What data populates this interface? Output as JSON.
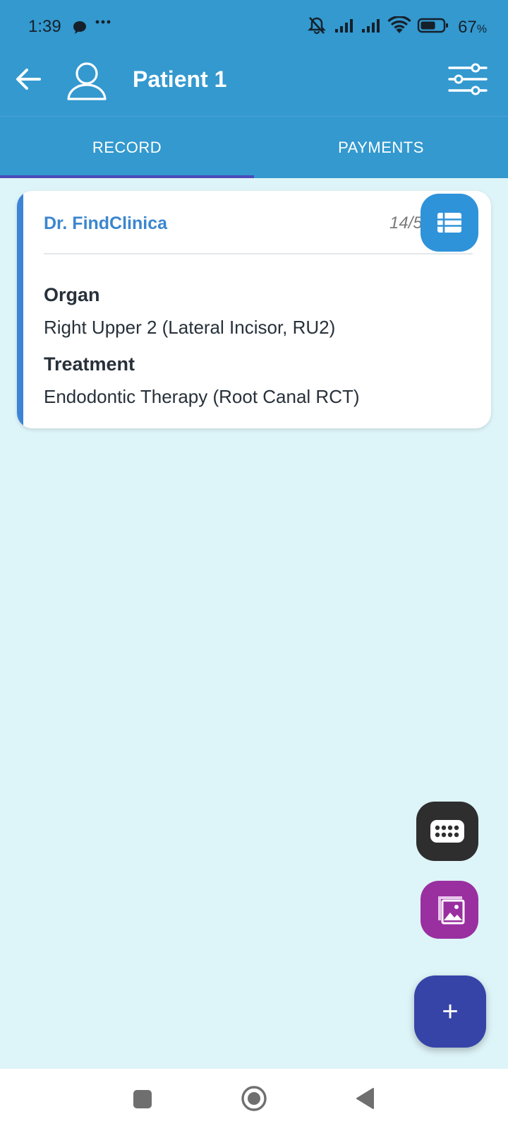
{
  "status_bar": {
    "time": "1:39",
    "battery_percent": "67",
    "battery_unit": "%",
    "battery_level": 0.67,
    "icons": [
      "chat-icon",
      "more-dots-icon",
      "mute-icon",
      "signal-icon",
      "signal-icon",
      "wifi-icon",
      "battery-icon"
    ]
  },
  "header": {
    "title": "Patient 1",
    "icons": [
      "back-arrow-icon",
      "person-icon",
      "filter-sliders-icon"
    ]
  },
  "tabs": [
    {
      "label": "RECORD",
      "active": true
    },
    {
      "label": "PAYMENTS",
      "active": false
    }
  ],
  "record_card": {
    "doctor": "Dr. FindClinica",
    "date": "14/5",
    "fields": [
      {
        "label": "Organ",
        "value": "Right Upper 2 (Lateral Incisor, RU2)"
      },
      {
        "label": "Treatment",
        "value": "Endodontic Therapy (Root Canal RCT)"
      }
    ],
    "icon": "list-icon"
  },
  "fabs": [
    {
      "name": "teeth-icon",
      "color": "#2e2e2e"
    },
    {
      "name": "gallery-icon",
      "color": "#9a2fa0"
    },
    {
      "name": "plus-icon",
      "label": "+",
      "color": "#3644a8"
    }
  ],
  "colors": {
    "header": "#3399cf",
    "background": "#ddf4f8",
    "tab_indicator": "#4a4bb8",
    "accent": "#3c84d6"
  }
}
